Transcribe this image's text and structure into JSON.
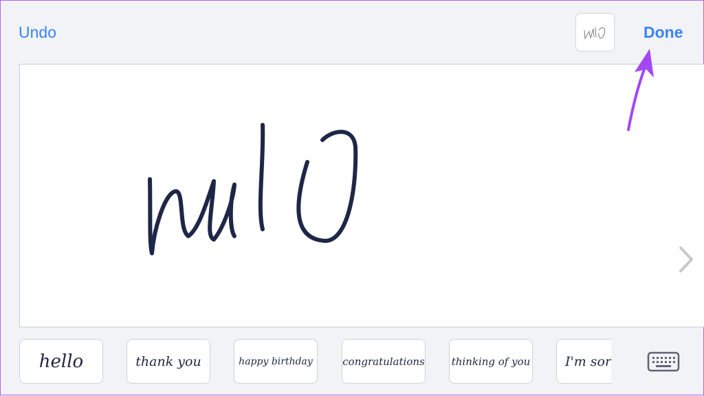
{
  "toolbar": {
    "undo_label": "Undo",
    "done_label": "Done",
    "thumbnail_text": "wl0"
  },
  "canvas": {
    "ink_color": "#1f2747"
  },
  "suggestions": [
    "hello",
    "thank you",
    "happy birthday",
    "congratulations",
    "thinking of you",
    "I'm sorry"
  ],
  "colors": {
    "accent": "#3a82f6",
    "annotation_arrow": "#a347f5"
  },
  "icons": {
    "next": "chevron-right-icon",
    "keyboard": "keyboard-icon",
    "annotation": "arrow-icon"
  }
}
